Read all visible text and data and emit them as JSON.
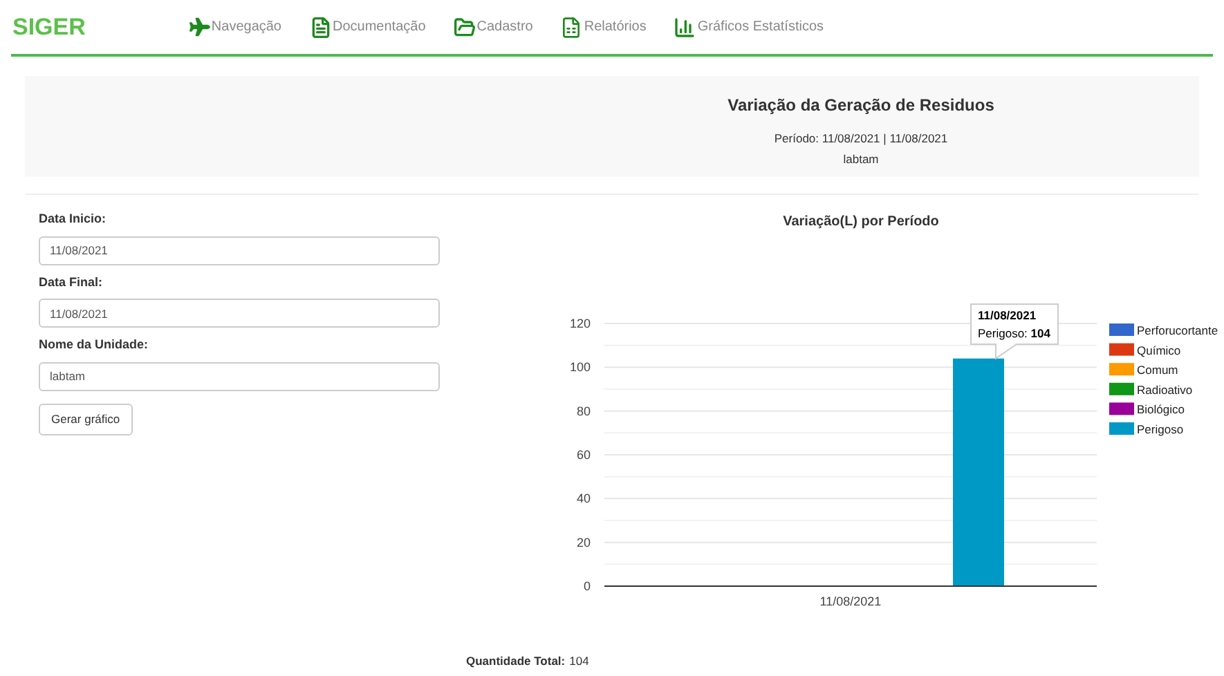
{
  "brand": "SIGER",
  "nav": [
    {
      "label": "Navegação",
      "kind": "plane"
    },
    {
      "label": "Documentação",
      "kind": "document"
    },
    {
      "label": "Cadastro",
      "kind": "folder"
    },
    {
      "label": "Relatórios",
      "kind": "report"
    },
    {
      "label": "Gráficos Estatísticos",
      "kind": "chart"
    }
  ],
  "header": {
    "title": "Variação da Geração de Residuos",
    "period": "Período: 11/08/2021 | 11/08/2021",
    "unit": "labtam"
  },
  "form": {
    "fields": [
      {
        "label": "Data Inicio:",
        "value": "11/08/2021"
      },
      {
        "label": "Data Final:",
        "value": "11/08/2021"
      },
      {
        "label": "Nome da Unidade:",
        "value": "labtam"
      }
    ],
    "button": "Gerar gráfico"
  },
  "chart": {
    "tooltip": {
      "title": "11/08/2021",
      "label": "Perigoso:",
      "value": "104"
    },
    "chart_data": {
      "type": "bar",
      "title": "Variação(L) por Período",
      "categories": [
        "11/08/2021"
      ],
      "series": [
        {
          "name": "Perforucortante",
          "color": "#3366cc",
          "values": [
            0
          ]
        },
        {
          "name": "Químico",
          "color": "#dc3912",
          "values": [
            0
          ]
        },
        {
          "name": "Comum",
          "color": "#ff9900",
          "values": [
            0
          ]
        },
        {
          "name": "Radioativo",
          "color": "#109618",
          "values": [
            0
          ]
        },
        {
          "name": "Biológico",
          "color": "#990099",
          "values": [
            0
          ]
        },
        {
          "name": "Perigoso",
          "color": "#0099c6",
          "values": [
            104
          ]
        }
      ],
      "ylim": [
        0,
        120
      ],
      "yticks": [
        0,
        20,
        40,
        60,
        80,
        100,
        120
      ],
      "grid": true,
      "legend": "right"
    }
  },
  "total": {
    "label": "Quantidade Total:",
    "value": "104"
  }
}
